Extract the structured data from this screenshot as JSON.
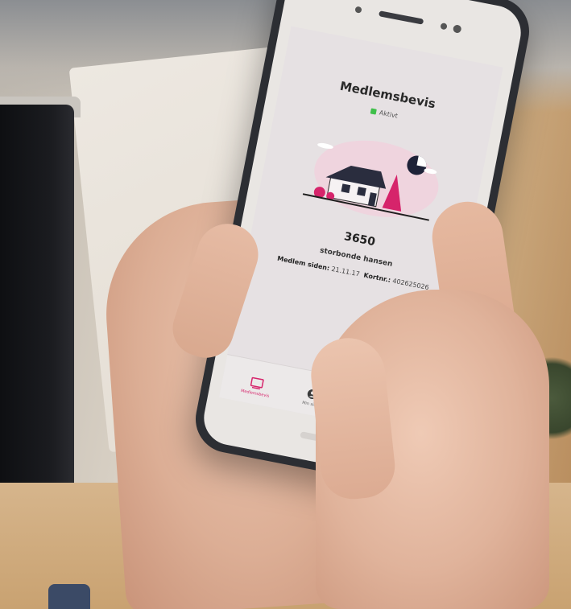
{
  "app": {
    "screen_title": "Medlemsbevis",
    "status_label": "Aktivt",
    "status_color": "#3fbf4a",
    "accent_color": "#d6246b",
    "member_number": "3650",
    "member_name": "storbonde hansen",
    "member_since_label": "Medlem siden:",
    "member_since_value": "21.11.17",
    "card_no_label": "Kortnr.:",
    "card_no_value": "402625026",
    "illustration": "house-icon",
    "tabs": [
      {
        "label": "Medlemsbevis",
        "icon": "card-icon",
        "active": true
      },
      {
        "label": "Min side",
        "icon": "user-icon",
        "active": false
      }
    ]
  }
}
